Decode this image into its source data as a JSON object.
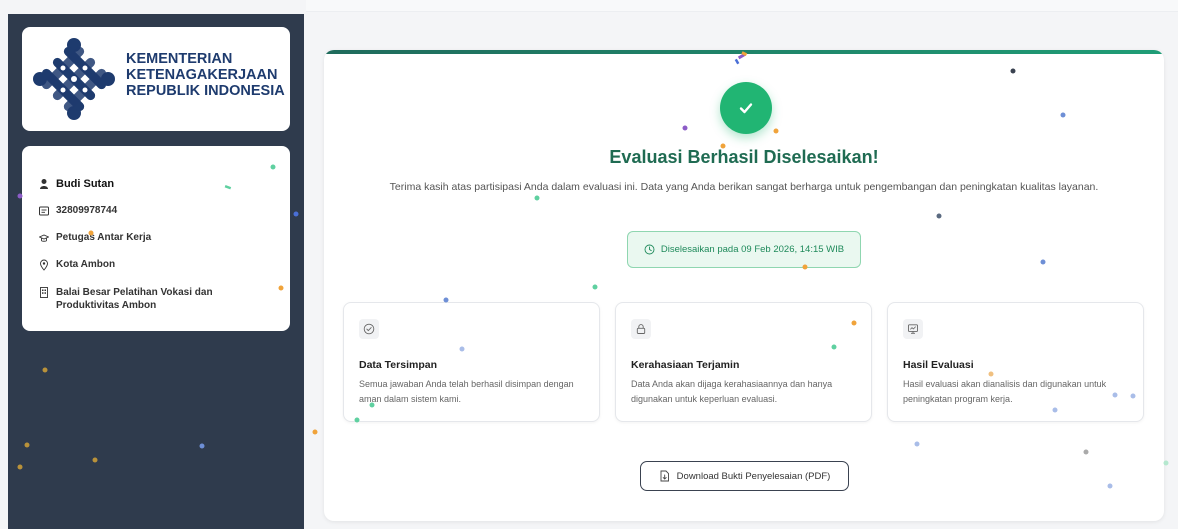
{
  "org": {
    "line1": "KEMENTERIAN",
    "line2": "KETENAGAKERJAAN",
    "line3": "REPUBLIK INDONESIA"
  },
  "profile": {
    "name": "Budi Sutan",
    "id_number": "32809978744",
    "role": "Petugas Antar Kerja",
    "city": "Kota Ambon",
    "office": "Balai Besar Pelatihan Vokasi dan Produktivitas Ambon"
  },
  "main": {
    "title": "Evaluasi Berhasil Diselesaikan!",
    "subtitle": "Terima kasih atas partisipasi Anda dalam evaluasi ini. Data yang Anda berikan sangat berharga untuk pengembangan dan peningkatan kualitas layanan.",
    "completed": "Diselesaikan pada 09 Feb 2026, 14:15 WIB",
    "features": [
      {
        "icon": "check-circle-icon",
        "title": "Data Tersimpan",
        "desc": "Semua jawaban Anda telah berhasil disimpan dengan aman dalam sistem kami."
      },
      {
        "icon": "lock-icon",
        "title": "Kerahasiaan Terjamin",
        "desc": "Data Anda akan dijaga kerahasiaannya dan hanya digunakan untuk keperluan evaluasi."
      },
      {
        "icon": "chart-icon",
        "title": "Hasil Evaluasi",
        "desc": "Hasil evaluasi akan dianalisis dan digunakan untuk peningkatan program kerja."
      }
    ],
    "download_label": "Download Bukti Penyelesaian (PDF)"
  },
  "colors": {
    "sidebar_bg": "#2f3b4d",
    "brand_blue": "#1e3b6e",
    "success_green": "#21b573",
    "title_green": "#1f6b52"
  }
}
